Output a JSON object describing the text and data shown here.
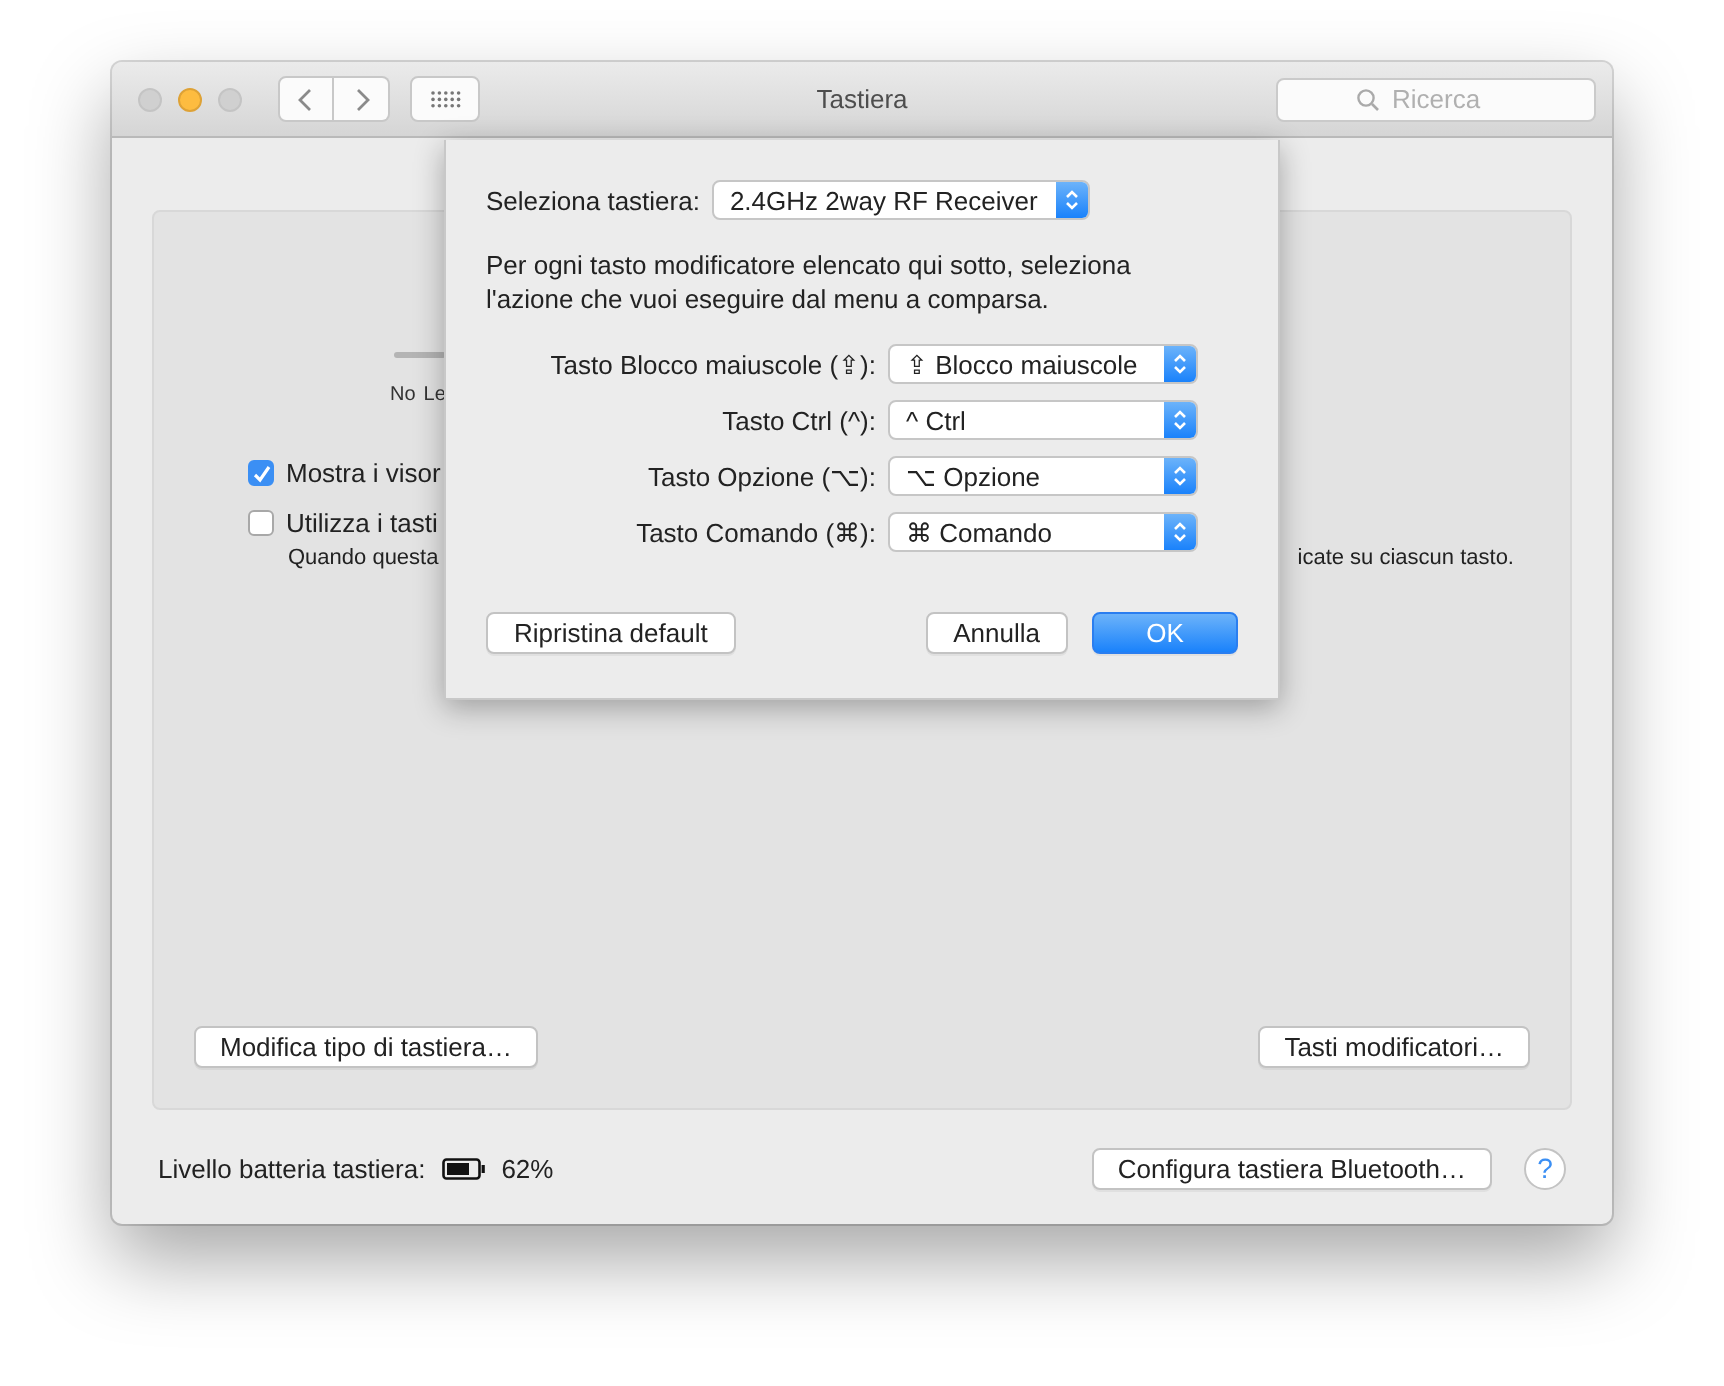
{
  "window": {
    "title": "Tastiera",
    "traffic_lights": [
      {
        "kind": "close",
        "enabled": false
      },
      {
        "kind": "minimize",
        "enabled": true
      },
      {
        "kind": "zoom",
        "enabled": false
      }
    ],
    "search": {
      "placeholder": "Ricerca"
    }
  },
  "background": {
    "slider_ticks": [
      "No",
      "Le"
    ],
    "checkboxes": [
      {
        "label": "Mostra i visor",
        "checked": true
      },
      {
        "label": "Utilizza i tasti",
        "checked": false
      }
    ],
    "caption_start": "Quando questa",
    "caption_end": "icate su ciascun tasto.",
    "buttons": [
      "Modifica tipo di tastiera…",
      "Tasti modificatori…"
    ]
  },
  "footer": {
    "battery_label": "Livello batteria tastiera:",
    "battery_reading": "62%",
    "configure_button": "Configura tastiera Bluetooth…",
    "help": "?"
  },
  "sheet": {
    "keyboard_label": "Seleziona tastiera:",
    "keyboard_value": "2.4GHz 2way RF Receiver",
    "description": "Per ogni tasto modificatore elencato qui sotto, seleziona l'azione che vuoi eseguire dal menu a comparsa.",
    "modifiers": [
      {
        "label": "Tasto Blocco maiuscole (⇪):",
        "value": "⇪ Blocco maiuscole"
      },
      {
        "label": "Tasto Ctrl (^):",
        "value": "^ Ctrl"
      },
      {
        "label": "Tasto Opzione (⌥):",
        "value": "⌥ Opzione"
      },
      {
        "label": "Tasto Comando (⌘):",
        "value": "⌘ Comando"
      }
    ],
    "buttons": [
      {
        "label": "Ripristina default",
        "default": false
      },
      {
        "label": "Annulla",
        "default": false
      },
      {
        "label": "OK",
        "default": true
      }
    ]
  }
}
